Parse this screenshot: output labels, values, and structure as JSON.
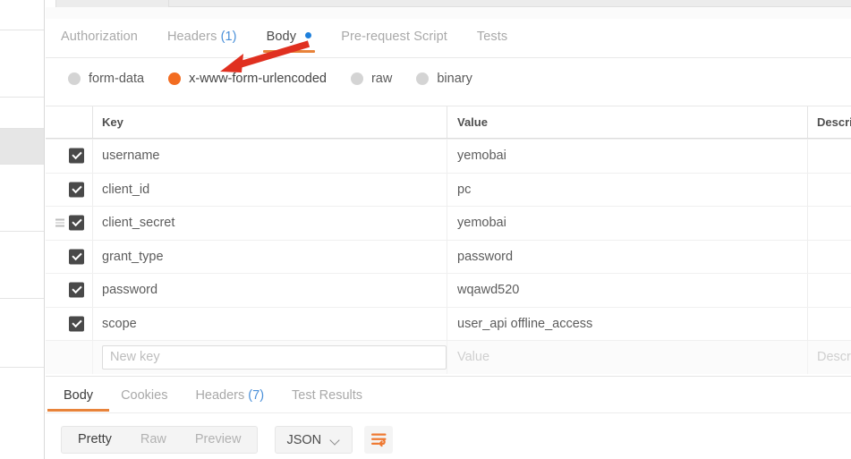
{
  "app": {
    "accent_orange": "#e8833a",
    "accent_radio": "#f26c21",
    "link_blue": "#4a90d9",
    "annotation_color": "#e03020"
  },
  "request_tabs": [
    {
      "label": "Authorization",
      "active": false,
      "count": null,
      "dot": false
    },
    {
      "label": "Headers",
      "active": false,
      "count": "(1)",
      "dot": false
    },
    {
      "label": "Body",
      "active": true,
      "count": null,
      "dot": true
    },
    {
      "label": "Pre-request Script",
      "active": false,
      "count": null,
      "dot": false
    },
    {
      "label": "Tests",
      "active": false,
      "count": null,
      "dot": false
    }
  ],
  "body_modes": [
    {
      "label": "form-data",
      "selected": false
    },
    {
      "label": "x-www-form-urlencoded",
      "selected": true
    },
    {
      "label": "raw",
      "selected": false
    },
    {
      "label": "binary",
      "selected": false
    }
  ],
  "kv_table": {
    "columns": [
      "Key",
      "Value",
      "Descrip"
    ],
    "rows": [
      {
        "checked": true,
        "key": "username",
        "value": "yemobai",
        "description": "",
        "drag_handle": false
      },
      {
        "checked": true,
        "key": "client_id",
        "value": "pc",
        "description": "",
        "drag_handle": false
      },
      {
        "checked": true,
        "key": "client_secret",
        "value": "yemobai",
        "description": "",
        "drag_handle": true
      },
      {
        "checked": true,
        "key": "grant_type",
        "value": "password",
        "description": "",
        "drag_handle": false
      },
      {
        "checked": true,
        "key": "password",
        "value": "wqawd520",
        "description": "",
        "drag_handle": false
      },
      {
        "checked": true,
        "key": "scope",
        "value": "user_api  offline_access",
        "description": "",
        "drag_handle": false
      }
    ],
    "new_row": {
      "key_placeholder": "New key",
      "value_placeholder": "Value",
      "description_placeholder": "Descri"
    }
  },
  "response_tabs": [
    {
      "label": "Body",
      "active": true,
      "count": null
    },
    {
      "label": "Cookies",
      "active": false,
      "count": null
    },
    {
      "label": "Headers",
      "active": false,
      "count": "(7)"
    },
    {
      "label": "Test Results",
      "active": false,
      "count": null
    }
  ],
  "response_toolbar": {
    "view_modes": [
      {
        "label": "Pretty",
        "active": true
      },
      {
        "label": "Raw",
        "active": false
      },
      {
        "label": "Preview",
        "active": false
      }
    ],
    "format": "JSON",
    "wrap_icon": "word-wrap-icon"
  }
}
